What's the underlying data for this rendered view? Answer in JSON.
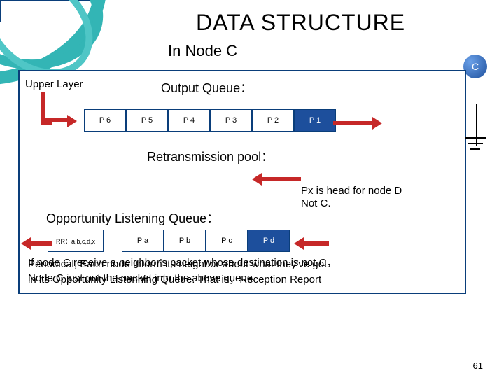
{
  "title": "DATA STRUCTURE",
  "subtitle": "In Node C",
  "badge": "C",
  "labels": {
    "upper_layer": "Upper Layer",
    "output_queue": "Output Queue：",
    "retrans_pool": "Retransmission pool：",
    "opp_queue": "Opportunity Listening Queue："
  },
  "output_packets": [
    "P 6",
    "P 5",
    "P 4",
    "P 3",
    "P 2",
    "P 1"
  ],
  "opp_packets": {
    "rr": "RR：a,b,c,d,x",
    "items": [
      "P a",
      "P b",
      "P c",
      "P d"
    ]
  },
  "px_note_l1": "Px is head for node D",
  "px_note_l2": "Not C.",
  "body_l1": "If node C receive a neighbor's packet whose destination is not C，",
  "body_l2": "Periodical, Each node inform its neighbor about what they've got",
  "body_l3": "Node C just put the packet into the above queue.",
  "body_l4": "in its Opportunity Listenning Queue. That is，Reception Report",
  "page_no": "61"
}
